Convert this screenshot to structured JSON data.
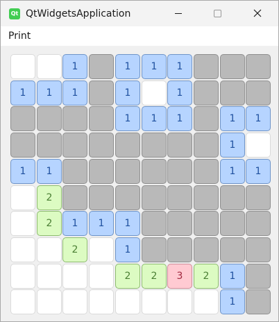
{
  "window": {
    "title": "QtWidgetsApplication",
    "icon_label": "Qt",
    "controls": [
      "minimize-icon",
      "maximize-icon",
      "close-icon"
    ]
  },
  "menu": {
    "items": [
      "Print"
    ]
  },
  "colors": {
    "hidden": "#b9b9b9",
    "revealed": "#ffffff",
    "one": "#b6d4ff",
    "two": "#dcfbc2",
    "three": "#ffcad2",
    "qt_green": "#41cd52"
  },
  "board": {
    "rows": 10,
    "cols": 10,
    "legend": "H = unrevealed, E = revealed empty, digit = revealed number",
    "grid": [
      [
        "E",
        "E",
        "1",
        "H",
        "1",
        "1",
        "1",
        "H",
        "H",
        "H"
      ],
      [
        "1",
        "1",
        "1",
        "H",
        "1",
        "E",
        "1",
        "H",
        "H",
        "H"
      ],
      [
        "H",
        "H",
        "H",
        "H",
        "1",
        "1",
        "1",
        "H",
        "1",
        "1"
      ],
      [
        "H",
        "H",
        "H",
        "H",
        "H",
        "H",
        "H",
        "H",
        "1",
        "E"
      ],
      [
        "1",
        "1",
        "H",
        "H",
        "H",
        "H",
        "H",
        "H",
        "1",
        "1"
      ],
      [
        "E",
        "2",
        "H",
        "H",
        "H",
        "H",
        "H",
        "H",
        "H",
        "H"
      ],
      [
        "E",
        "2",
        "1",
        "1",
        "1",
        "H",
        "H",
        "H",
        "H",
        "H"
      ],
      [
        "E",
        "E",
        "2",
        "E",
        "1",
        "H",
        "H",
        "H",
        "H",
        "H"
      ],
      [
        "E",
        "E",
        "E",
        "E",
        "2",
        "2",
        "3",
        "2",
        "1",
        "H"
      ],
      [
        "E",
        "E",
        "E",
        "E",
        "E",
        "E",
        "E",
        "E",
        "1",
        "H"
      ]
    ]
  }
}
